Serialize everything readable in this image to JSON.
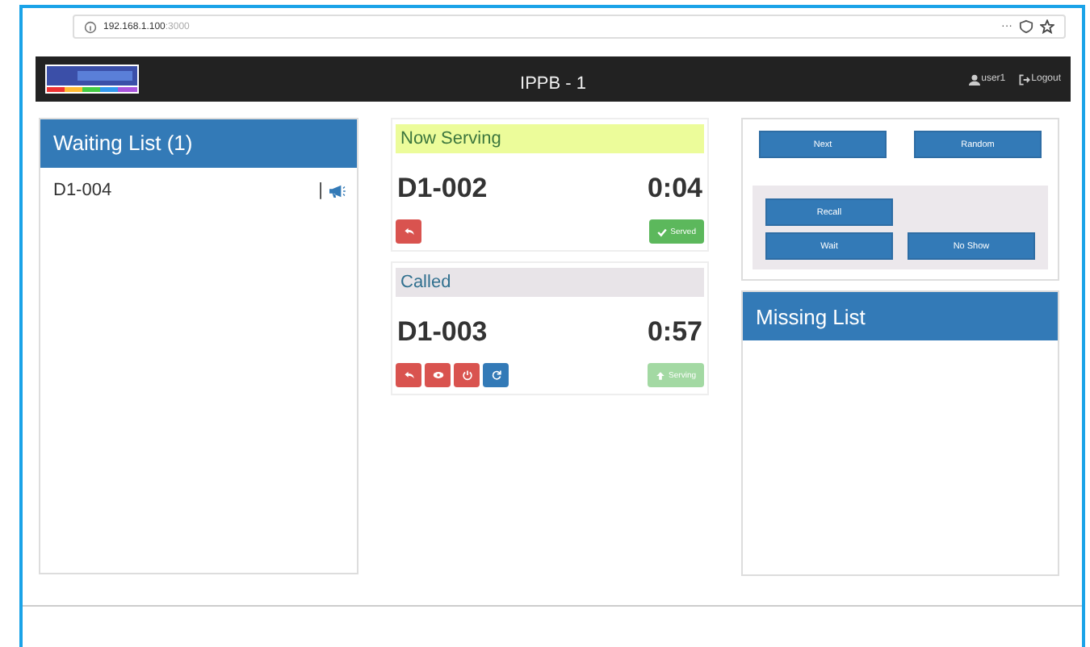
{
  "browser": {
    "host": "192.168.1.100",
    "port": ":3000",
    "menu": "···"
  },
  "navbar": {
    "title": "IPPB - 1",
    "user": "user1",
    "logout": "Logout"
  },
  "waiting_list": {
    "title": "Waiting List (1)",
    "items": [
      {
        "ticket": "D1-004",
        "separator": "|"
      }
    ]
  },
  "now_serving": {
    "title": "Now Serving",
    "ticket": "D1-002",
    "time": "0:04",
    "actions": [
      {
        "kind": "undo",
        "color": "#d9534f"
      }
    ],
    "done": {
      "label": "Served",
      "disabled": false
    }
  },
  "called": {
    "title": "Called",
    "ticket": "D1-003",
    "time": "0:57",
    "actions": [
      {
        "kind": "undo",
        "color": "#d9534f"
      },
      {
        "kind": "eye",
        "color": "#d9534f"
      },
      {
        "kind": "power",
        "color": "#d9534f"
      },
      {
        "kind": "refresh",
        "color": "#337ab7"
      }
    ],
    "done": {
      "label": "Serving",
      "disabled": true
    }
  },
  "controls": {
    "top": [
      "Next",
      "Random"
    ],
    "recall": "Recall",
    "bottom": [
      "Wait",
      "No Show"
    ]
  },
  "missing_list": {
    "title": "Missing List"
  }
}
